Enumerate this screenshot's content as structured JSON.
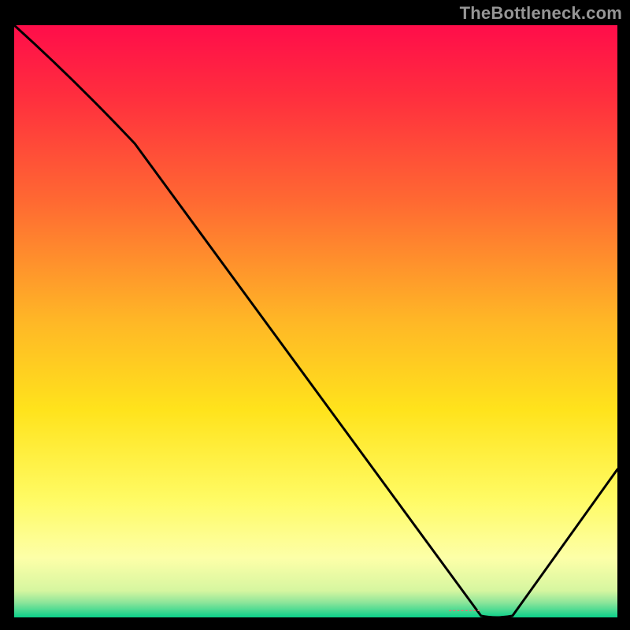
{
  "watermark": {
    "text": "TheBottleneck.com"
  },
  "chart_data": {
    "type": "line",
    "title": "",
    "xlabel": "",
    "ylabel": "",
    "x": [
      0,
      20,
      80,
      100
    ],
    "values": [
      100,
      80,
      0,
      25
    ],
    "xlim": [
      0,
      100
    ],
    "ylim": [
      0,
      100
    ],
    "annotations": [
      {
        "label_key": "marker.text",
        "x": 77,
        "y": 0
      }
    ],
    "background_gradient": {
      "orientation": "vertical",
      "stops": [
        {
          "offset": 0.0,
          "color": "#ff0d4a"
        },
        {
          "offset": 0.12,
          "color": "#ff2e3e"
        },
        {
          "offset": 0.3,
          "color": "#ff6a32"
        },
        {
          "offset": 0.5,
          "color": "#ffb726"
        },
        {
          "offset": 0.65,
          "color": "#ffe31c"
        },
        {
          "offset": 0.8,
          "color": "#fffb64"
        },
        {
          "offset": 0.9,
          "color": "#fdffa8"
        },
        {
          "offset": 0.955,
          "color": "#d6f6a0"
        },
        {
          "offset": 0.975,
          "color": "#8de59a"
        },
        {
          "offset": 1.0,
          "color": "#0bd08a"
        }
      ]
    }
  },
  "marker": {
    "text": "--------"
  }
}
